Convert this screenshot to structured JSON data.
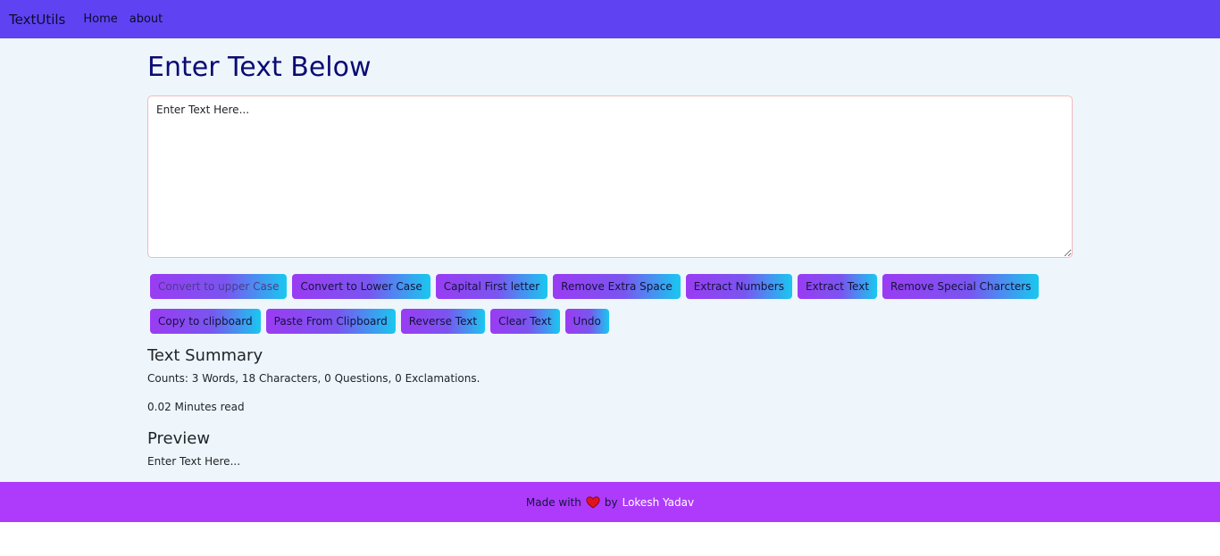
{
  "navbar": {
    "brand": "TextUtils",
    "links": [
      "Home",
      "about"
    ]
  },
  "main": {
    "title": "Enter Text Below",
    "textarea_placeholder": "Enter Text Here...",
    "buttons_row1": [
      "Convert to upper Case",
      "Convert to Lower Case",
      "Capital First letter",
      "Remove Extra Space",
      "Extract Numbers",
      "Extract Text",
      "Remove Special Charcters"
    ],
    "buttons_row2": [
      "Copy to clipboard",
      "Paste From Clipboard",
      "Reverse Text",
      "Clear Text",
      "Undo"
    ]
  },
  "summary": {
    "title": "Text Summary",
    "counts": "Counts: 3 Words, 18 Characters, 0 Questions, 0 Exclamations.",
    "read_time": "0.02 Minutes read"
  },
  "preview": {
    "title": "Preview",
    "text": "Enter Text Here..."
  },
  "footer": {
    "made_with": "Made with",
    "by": "by",
    "author": "Lokesh Yadav",
    "heart_icon": "heart-icon"
  },
  "colors": {
    "navbar": "#5f43f2",
    "page_background": "#eef6fc",
    "title": "#0b0b73",
    "footer": "#ae3bfb",
    "button_gradient_start": "#9a3cf2",
    "button_gradient_end": "#19c8ef",
    "heart": "#e0141e"
  }
}
